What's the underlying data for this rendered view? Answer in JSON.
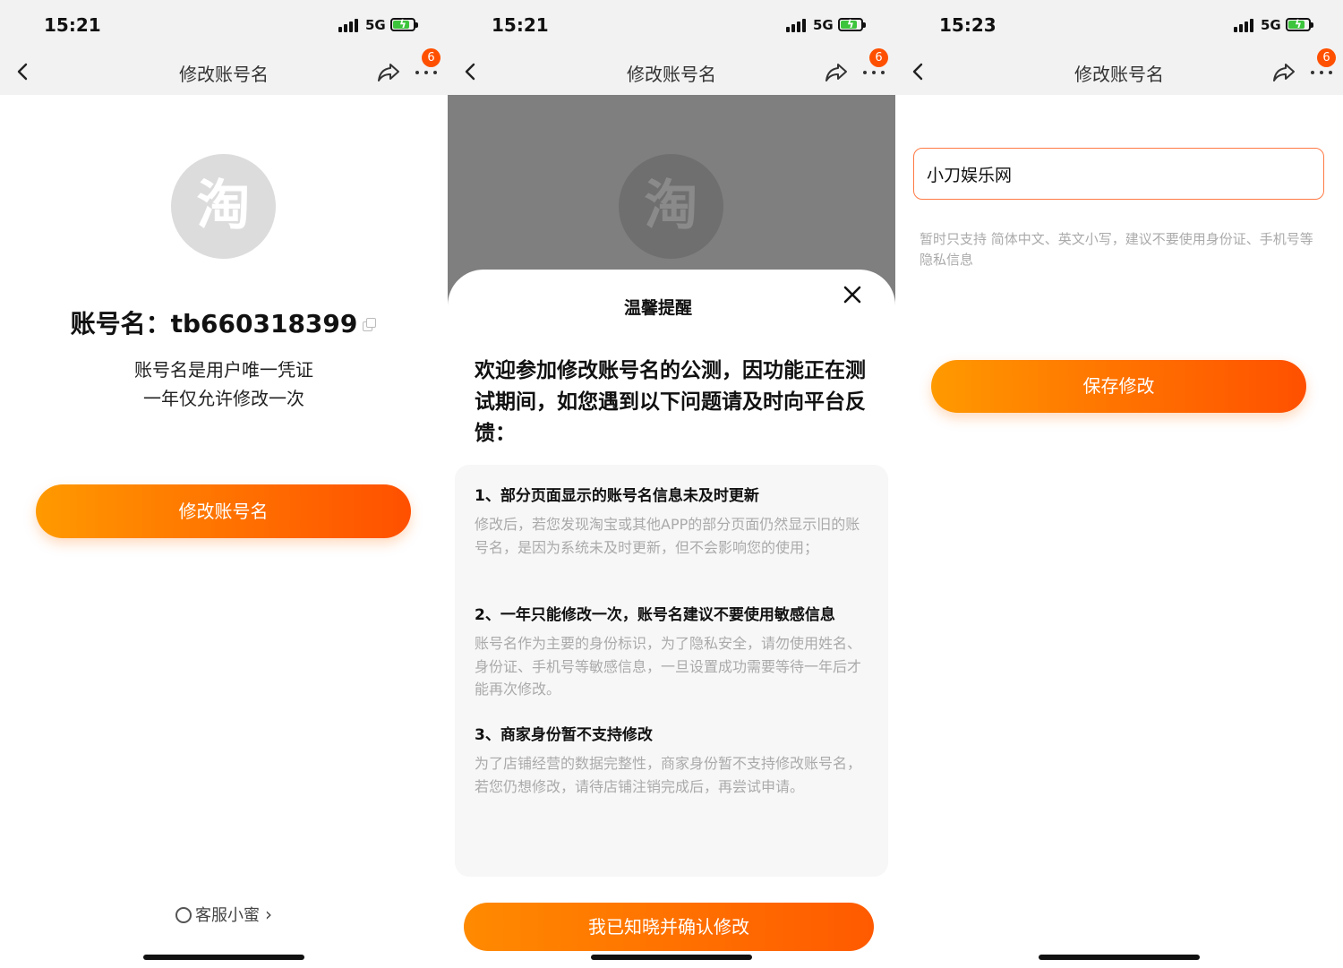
{
  "screens": [
    {
      "status": {
        "time": "15:21",
        "network": "5G"
      },
      "nav": {
        "title": "修改账号名",
        "badge_count": "6"
      },
      "avatar_glyph": "淘",
      "account_line": "账号名：tb660318399",
      "description": [
        "账号名是用户唯一凭证",
        "一年仅允许修改一次"
      ],
      "primary_button": "修改账号名",
      "service_link": "客服小蜜"
    },
    {
      "status": {
        "time": "15:21",
        "network": "5G"
      },
      "nav": {
        "title": "修改账号名",
        "badge_count": "6"
      },
      "avatar_glyph": "淘",
      "dialog": {
        "title": "温馨提醒",
        "intro": "欢迎参加修改账号名的公测，因功能正在测试期间，如您遇到以下问题请及时向平台反馈：",
        "items": [
          {
            "heading": "1、部分页面显示的账号名信息未及时更新",
            "body": "修改后，若您发现淘宝或其他APP的部分页面仍然显示旧的账号名，是因为系统未及时更新，但不会影响您的使用；"
          },
          {
            "heading": "2、一年只能修改一次，账号名建议不要使用敏感信息",
            "body": "账号名作为主要的身份标识，为了隐私安全，请勿使用姓名、身份证、手机号等敏感信息，一旦设置成功需要等待一年后才能再次修改。"
          },
          {
            "heading": "3、商家身份暂不支持修改",
            "body": "为了店铺经营的数据完整性，商家身份暂不支持修改账号名，若您仍想修改，请待店铺注销完成后，再尝试申请。"
          }
        ],
        "confirm_button": "我已知晓并确认修改"
      }
    },
    {
      "status": {
        "time": "15:23",
        "network": "5G"
      },
      "nav": {
        "title": "修改账号名",
        "badge_count": "6"
      },
      "input_value": "小刀娱乐网",
      "hint": "暂时只支持 简体中文、英文小写，建议不要使用身份证、手机号等隐私信息",
      "save_button": "保存修改"
    }
  ],
  "colors": {
    "accent": "#ff5000",
    "accent_start": "#ff9a00",
    "battery": "#3cc43c",
    "overlay": "#7f7f7f"
  }
}
